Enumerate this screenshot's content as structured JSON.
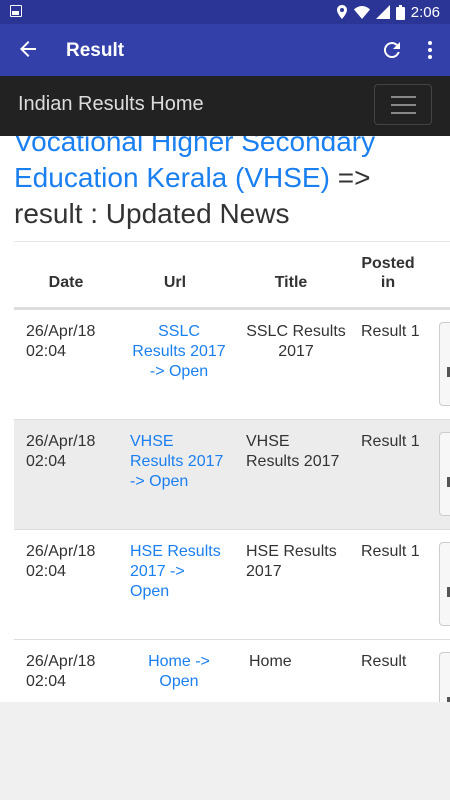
{
  "status": {
    "time": "2:06"
  },
  "appbar": {
    "title": "Result"
  },
  "navbar": {
    "brand": "Indian Results Home"
  },
  "heading": {
    "link_text": "Vocational Higher Secondary Education Kerala (VHSE)",
    "rest": " => result : Updated News"
  },
  "table": {
    "headers": {
      "date": "Date",
      "url": "Url",
      "title": "Title",
      "posted_line1": "Posted",
      "posted_line2": "in"
    },
    "rows": [
      {
        "date1": "26/Apr/18",
        "date2": "02:04",
        "url": "SSLC Results 2017 -> Open",
        "title": "SSLC Results 2017",
        "posted": "Result 1"
      },
      {
        "date1": "26/Apr/18",
        "date2": "02:04",
        "url": "VHSE Results 2017 -> Open",
        "title": "VHSE Results 2017",
        "posted": "Result 1"
      },
      {
        "date1": "26/Apr/18",
        "date2": "02:04",
        "url": "HSE Results 2017 -> Open",
        "title": "HSE Results 2017",
        "posted": "Result 1"
      },
      {
        "date1": "26/Apr/18",
        "date2": "02:04",
        "url": "Home -> Open",
        "title": "Home",
        "posted": "Result"
      }
    ]
  }
}
